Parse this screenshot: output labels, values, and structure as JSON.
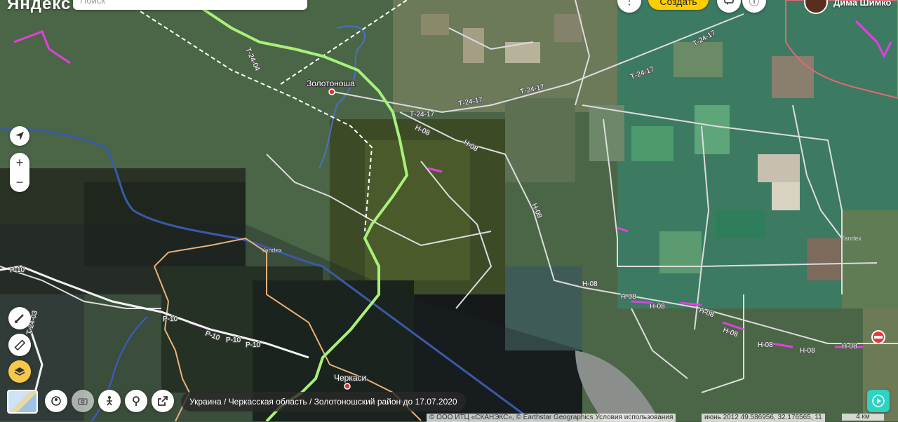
{
  "app": {
    "logo_text": "Яндекс"
  },
  "search": {
    "placeholder": "Поиск"
  },
  "header": {
    "create_label": "Создать",
    "user_name": "Дима Шимко"
  },
  "map": {
    "cities": [
      {
        "name": "Золотоноша"
      },
      {
        "name": "Черкаси"
      }
    ],
    "roads": [
      "Т-24-17",
      "Н-08",
      "Р-10",
      "Т-24-03",
      "Т-24-04"
    ],
    "watermark": "Yandex"
  },
  "zoom": {
    "in_label": "+",
    "out_label": "−"
  },
  "breadcrumb": {
    "text": "Украина / Черкасская область / Золотоношский район до 17.07.2020"
  },
  "attribution": {
    "text": "© ООО ИТЦ «СКАНЭКС», © Earthstar Geographics Условия использования",
    "imagery_date": "июнь 2012",
    "coords": "49.586956, 32.176565, 11"
  },
  "scale": {
    "label": "4 км"
  },
  "colors": {
    "accent_yellow": "#ffcc00",
    "route_green": "#a8f07a",
    "road_magenta": "#e040e0",
    "border_pink": "#f3a29b"
  },
  "icons": [
    "location-arrow-icon",
    "ruler-icon",
    "layers-icon",
    "route-icon",
    "panorama-icon",
    "camera-icon",
    "person-icon",
    "pin-icon",
    "share-icon",
    "message-icon",
    "help-icon",
    "play-icon",
    "no-entry-icon",
    "more-icon"
  ]
}
